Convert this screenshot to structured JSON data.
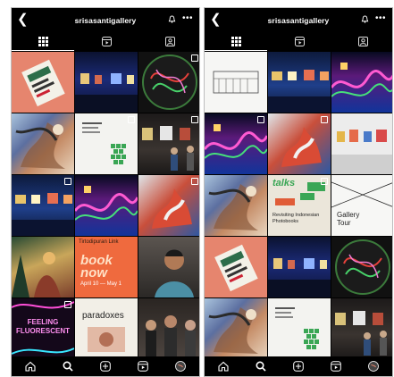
{
  "profile": {
    "username": "srisasantigallery"
  },
  "left_tiles": [
    {
      "kind": "orange-magazine"
    },
    {
      "kind": "dark-gallery"
    },
    {
      "kind": "neon-circle"
    },
    {
      "kind": "collage-figure"
    },
    {
      "kind": "green-checker"
    },
    {
      "kind": "exhibition-room"
    },
    {
      "kind": "blue-gallery"
    },
    {
      "kind": "neon-hall"
    },
    {
      "kind": "red-splash"
    },
    {
      "kind": "forest-figure"
    },
    {
      "kind": "orange-poster"
    },
    {
      "kind": "man-portrait"
    },
    {
      "kind": "feeling-fluorescent"
    },
    {
      "kind": "paradoxes"
    },
    {
      "kind": "crowd"
    }
  ],
  "right_tiles": [
    {
      "kind": "facade"
    },
    {
      "kind": "blue-gallery"
    },
    {
      "kind": "neon-hall"
    },
    {
      "kind": "neon-hall"
    },
    {
      "kind": "red-splash"
    },
    {
      "kind": "white-gallery"
    },
    {
      "kind": "collage-figure"
    },
    {
      "kind": "book-event"
    },
    {
      "kind": "gallery-tour"
    },
    {
      "kind": "orange-magazine"
    },
    {
      "kind": "dark-gallery"
    },
    {
      "kind": "neon-circle"
    },
    {
      "kind": "collage-figure"
    },
    {
      "kind": "green-checker"
    },
    {
      "kind": "exhibition-room"
    }
  ],
  "poster_texts": {
    "tirtodipuran": "Tirtodipuran Link",
    "booknow": "book now",
    "dates": "April 10 — May 1",
    "feeling": "FEELING FLUORESCENT",
    "paradoxes": "paradoxes",
    "talks": "talks",
    "book_title": "Revisiting Indonesian Photobooks",
    "tour_title": "Gallery Tour"
  },
  "colors": {
    "background": "#000000",
    "text": "#ffffff",
    "accent_orange": "#ef6a3e",
    "accent_green": "#3aa655"
  },
  "icons": {
    "back": "chevron-left-icon",
    "notify": "bell-icon",
    "more": "more-icon",
    "grid_tab": "grid-icon",
    "reels_tab": "reels-icon",
    "tagged_tab": "tagged-icon",
    "home": "home-icon",
    "search": "search-icon",
    "create": "plus-icon",
    "reels": "reels-icon",
    "profile": "avatar"
  }
}
